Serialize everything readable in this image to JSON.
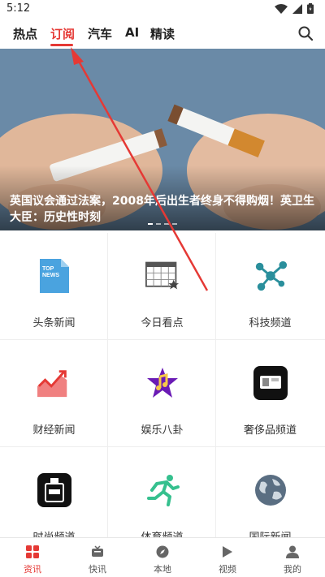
{
  "status_bar": {
    "time": "5:12"
  },
  "tabs": [
    {
      "label": "热点"
    },
    {
      "label": "订阅"
    },
    {
      "label": "汽车"
    },
    {
      "label": "AI"
    },
    {
      "label": "精读"
    }
  ],
  "active_tab": "订阅",
  "banner": {
    "title": "英国议会通过法案，2008年后出生者终身不得购烟！英卫生大臣：历史性时刻",
    "page_count": 4,
    "current_page": 1
  },
  "channels": [
    {
      "label": "头条新闻",
      "icon": "top-news-icon"
    },
    {
      "label": "今日看点",
      "icon": "calendar-star-icon"
    },
    {
      "label": "科技频道",
      "icon": "molecule-icon"
    },
    {
      "label": "财经新闻",
      "icon": "trend-chart-icon"
    },
    {
      "label": "娱乐八卦",
      "icon": "music-star-icon"
    },
    {
      "label": "奢侈品频道",
      "icon": "luxury-icon"
    },
    {
      "label": "时尚频道",
      "icon": "perfume-icon"
    },
    {
      "label": "体育频道",
      "icon": "runner-icon"
    },
    {
      "label": "国际新闻",
      "icon": "globe-icon"
    }
  ],
  "bottom_nav": [
    {
      "label": "资讯",
      "icon": "grid-icon"
    },
    {
      "label": "快讯",
      "icon": "tv-icon"
    },
    {
      "label": "本地",
      "icon": "compass-icon"
    },
    {
      "label": "视频",
      "icon": "play-icon"
    },
    {
      "label": "我的",
      "icon": "user-icon"
    }
  ],
  "active_nav": "资讯",
  "colors": {
    "accent": "#e53935",
    "annotation_arrow": "#e53935"
  }
}
